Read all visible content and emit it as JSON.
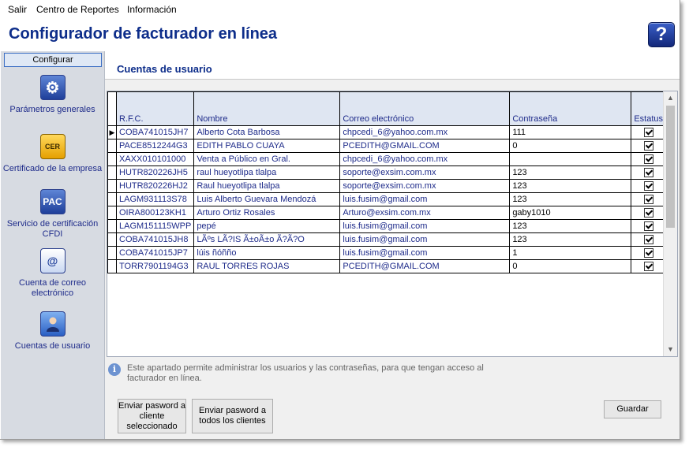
{
  "menu": [
    "Salir",
    "Centro de Reportes",
    "Información"
  ],
  "title": "Configurador de facturador en línea",
  "help_label": "?",
  "sidebar": {
    "header": "Configurar",
    "items": [
      {
        "label": "Parámetros generales",
        "icon": "gear-icon",
        "glyph": "⚙"
      },
      {
        "label": "Certificado de la empresa",
        "icon": "certificate-icon",
        "glyph": "CER"
      },
      {
        "label": "Servicio de certificación CFDI",
        "icon": "pac-icon",
        "glyph": "PAC"
      },
      {
        "label": "Cuenta de correo electrónico",
        "icon": "email-icon",
        "glyph": "@"
      },
      {
        "label": "Cuentas de usuario",
        "icon": "user-icon",
        "glyph": "👤"
      }
    ]
  },
  "section_title": "Cuentas de usuario",
  "grid": {
    "columns": [
      "R.F.C.",
      "Nombre",
      "Correo electrónico",
      "Contraseña",
      "Estatus"
    ],
    "rows": [
      {
        "rfc": "COBA741015JH7",
        "nombre": "Alberto Cota Barbosa",
        "correo": "chpcedi_6@yahoo.com.mx",
        "pass": "111",
        "estatus": true
      },
      {
        "rfc": "PACE8512244G3",
        "nombre": "EDITH PABLO CUAYA",
        "correo": "PCEDITH@GMAIL.COM",
        "pass": "0",
        "estatus": true
      },
      {
        "rfc": "XAXX010101000",
        "nombre": "Venta a Público en Gral.",
        "correo": "chpcedi_6@yahoo.com.mx",
        "pass": "",
        "estatus": true
      },
      {
        "rfc": "HUTR820226JH5",
        "nombre": "raul hueyotlipa tlalpa",
        "correo": "soporte@exsim.com.mx",
        "pass": "123",
        "estatus": true
      },
      {
        "rfc": "HUTR820226HJ2",
        "nombre": "Raul hueyotlipa tlalpa",
        "correo": "soporte@exsim.com.mx",
        "pass": "123",
        "estatus": true
      },
      {
        "rfc": "LAGM931113S78",
        "nombre": "Luis Alberto Guevara Mendozá",
        "correo": "luis.fusim@gmail.com",
        "pass": "123",
        "estatus": true
      },
      {
        "rfc": "OIRA800123KH1",
        "nombre": "Arturo Ortiz Rosales",
        "correo": "Arturo@exsim.com.mx",
        "pass": "gaby1010",
        "estatus": true
      },
      {
        "rfc": "LAGM151115WPP",
        "nombre": "pepé",
        "correo": "luis.fusim@gmail.com",
        "pass": "123",
        "estatus": true
      },
      {
        "rfc": "COBA741015JH8",
        "nombre": "LÃºs LÃ?IS Ã±oÃ±o Ã?Ã?O",
        "correo": "luis.fusim@gmail.com",
        "pass": "123",
        "estatus": true
      },
      {
        "rfc": "COBA741015JP7",
        "nombre": "lúis ñóñño",
        "correo": "luis.fusim@gmail.com",
        "pass": "1",
        "estatus": true
      },
      {
        "rfc": "TORR7901194G3",
        "nombre": "RAUL TORRES ROJAS",
        "correo": "PCEDITH@GMAIL.COM",
        "pass": "0",
        "estatus": true
      }
    ]
  },
  "info_text": "Este apartado permite administrar los usuarios y las contraseñas, para que tengan acceso al facturador en línea.",
  "buttons": {
    "send_selected": "Enviar pasword a cliente seleccionado",
    "send_all": "Enviar pasword a todos los clientes",
    "save": "Guardar"
  },
  "colors": {
    "title": "#0d2d8a",
    "sidebar_bg": "#d7dbe2",
    "grid_header_bg": "#dfe6f2"
  }
}
